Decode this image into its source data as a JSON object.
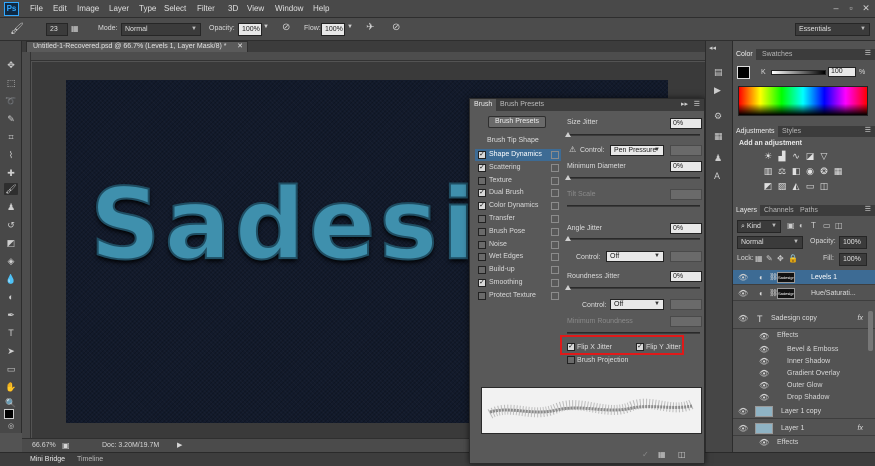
{
  "menu": {
    "items": [
      "File",
      "Edit",
      "Image",
      "Layer",
      "Type",
      "Select",
      "Filter",
      "3D",
      "View",
      "Window",
      "Help"
    ]
  },
  "options_bar": {
    "brush_size": "23",
    "mode_label": "Mode:",
    "mode_value": "Normal",
    "opacity_label": "Opacity:",
    "opacity_value": "100%",
    "flow_label": "Flow:",
    "flow_value": "100%",
    "workspace": "Essentials"
  },
  "document": {
    "tab_title": "Untitled-1-Recovered.psd @ 66.7% (Levels 1, Layer Mask/8) *",
    "canvas_text": "Sadesi",
    "zoom": "66.67%",
    "doc_size": "Doc: 3.20M/19.7M"
  },
  "bottom_tabs": [
    "Mini Bridge",
    "Timeline"
  ],
  "brush_panel": {
    "tabs": [
      "Brush",
      "Brush Presets"
    ],
    "presets_button": "Brush Presets",
    "tip_shape": "Brush Tip Shape",
    "options": [
      {
        "label": "Shape Dynamics",
        "checked": true,
        "selected": true
      },
      {
        "label": "Scattering",
        "checked": true,
        "selected": false
      },
      {
        "label": "Texture",
        "checked": false,
        "selected": false
      },
      {
        "label": "Dual Brush",
        "checked": true,
        "selected": false
      },
      {
        "label": "Color Dynamics",
        "checked": true,
        "selected": false
      },
      {
        "label": "Transfer",
        "checked": false,
        "selected": false
      },
      {
        "label": "Brush Pose",
        "checked": false,
        "selected": false
      },
      {
        "label": "Noise",
        "checked": false,
        "selected": false
      },
      {
        "label": "Wet Edges",
        "checked": false,
        "selected": false
      },
      {
        "label": "Build-up",
        "checked": false,
        "selected": false
      },
      {
        "label": "Smoothing",
        "checked": true,
        "selected": false
      },
      {
        "label": "Protect Texture",
        "checked": false,
        "selected": false
      }
    ],
    "size_jitter_label": "Size Jitter",
    "size_jitter_value": "0%",
    "control_label": "Control:",
    "size_control": "Pen Pressure",
    "min_diameter_label": "Minimum Diameter",
    "min_diameter_value": "0%",
    "tilt_scale_label": "Tilt Scale",
    "angle_jitter_label": "Angle Jitter",
    "angle_jitter_value": "0%",
    "angle_control": "Off",
    "roundness_jitter_label": "Roundness Jitter",
    "roundness_jitter_value": "0%",
    "roundness_control": "Off",
    "min_roundness_label": "Minimum Roundness",
    "flip_x": "Flip X Jitter",
    "flip_y": "Flip Y Jitter",
    "brush_projection": "Brush Projection"
  },
  "color_panel": {
    "tabs": [
      "Color",
      "Swatches"
    ],
    "k_label": "K",
    "k_value": "100",
    "percent": "%"
  },
  "adjustments_panel": {
    "tabs": [
      "Adjustments",
      "Styles"
    ],
    "heading": "Add an adjustment"
  },
  "layers_panel": {
    "tabs": [
      "Layers",
      "Channels",
      "Paths"
    ],
    "kind": "Kind",
    "blend_mode": "Normal",
    "opacity_label": "Opacity:",
    "opacity_value": "100%",
    "lock_label": "Lock:",
    "fill_label": "Fill:",
    "fill_value": "100%",
    "thumb_text": "Sadesign",
    "layers": [
      "Levels 1",
      "Hue/Saturati...",
      "Sadesign copy",
      "Layer 1 copy",
      "Layer 1"
    ],
    "effects_label": "Effects",
    "effects": [
      "Bevel & Emboss",
      "Inner Shadow",
      "Gradient Overlay",
      "Outer Glow",
      "Drop Shadow"
    ],
    "fx": "fx"
  },
  "colors": {
    "accent_selection": "#3d6b94",
    "highlight_box": "#e01919",
    "canvas_bg": "#121a2b",
    "text_fill": "#3f90ad"
  }
}
